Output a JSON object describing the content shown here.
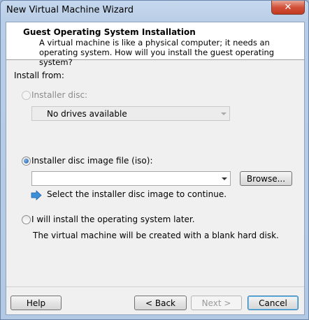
{
  "window": {
    "title": "New Virtual Machine Wizard",
    "close_label": "✕"
  },
  "header": {
    "title": "Guest Operating System Installation",
    "description": "A virtual machine is like a physical computer; it needs an operating system. How will you install the guest operating system?"
  },
  "install_from": {
    "label": "Install from:",
    "installer_disc": {
      "label": "Installer disc:",
      "selected": false,
      "enabled": false,
      "dropdown_value": "No drives available"
    },
    "iso": {
      "label": "Installer disc image file (iso):",
      "selected": true,
      "path_value": "",
      "browse_label": "Browse...",
      "hint": "Select the installer disc image to continue."
    },
    "later": {
      "label": "I will install the operating system later.",
      "selected": false,
      "note": "The virtual machine will be created with a blank hard disk."
    }
  },
  "footer": {
    "help_label": "Help",
    "back_label": "< Back",
    "next_label": "Next >",
    "cancel_label": "Cancel"
  },
  "colors": {
    "info_arrow": "#3b8ed8",
    "radio_selected": "#1d5aa8"
  }
}
